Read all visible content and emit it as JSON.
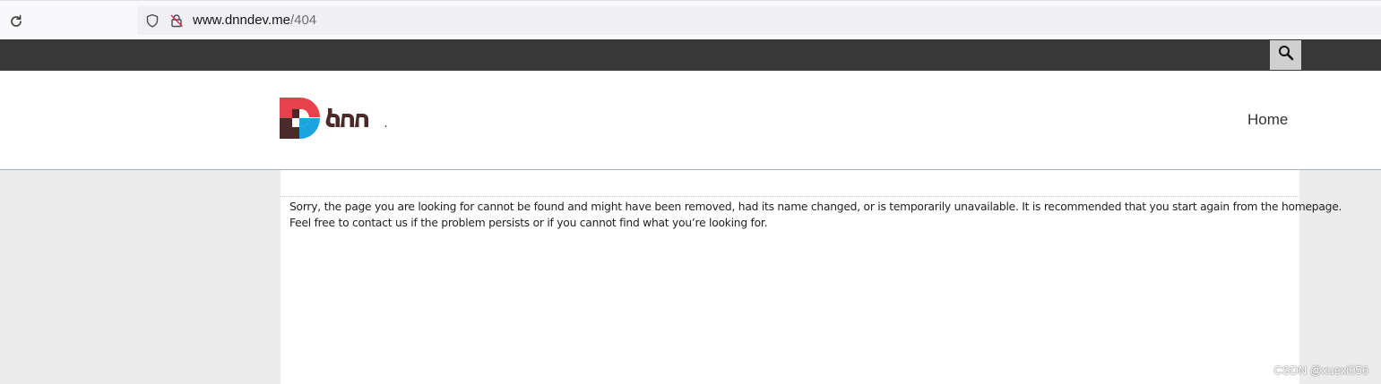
{
  "browser": {
    "url_host": "www.dnndev.me",
    "url_path": "/404"
  },
  "site": {
    "logo_text": "dnn",
    "nav": {
      "home_label": "Home"
    }
  },
  "error_page": {
    "line1": "Sorry, the page you are looking for cannot be found and might have been removed, had its name changed, or is temporarily unavailable. It is recommended that you start again from the homepage.",
    "line2": "Feel free to contact us if the problem persists or if you cannot find what you’re looking for."
  },
  "watermark": "CSDN @xuexi056",
  "colors": {
    "topbar": "#383838",
    "logo_red": "#e8414b",
    "logo_blue": "#1aa5e0",
    "logo_dark": "#4a2a2a"
  },
  "icons": {
    "reload": "reload-icon",
    "shield": "shield-icon",
    "lock": "lock-icon",
    "search": "search-icon"
  }
}
